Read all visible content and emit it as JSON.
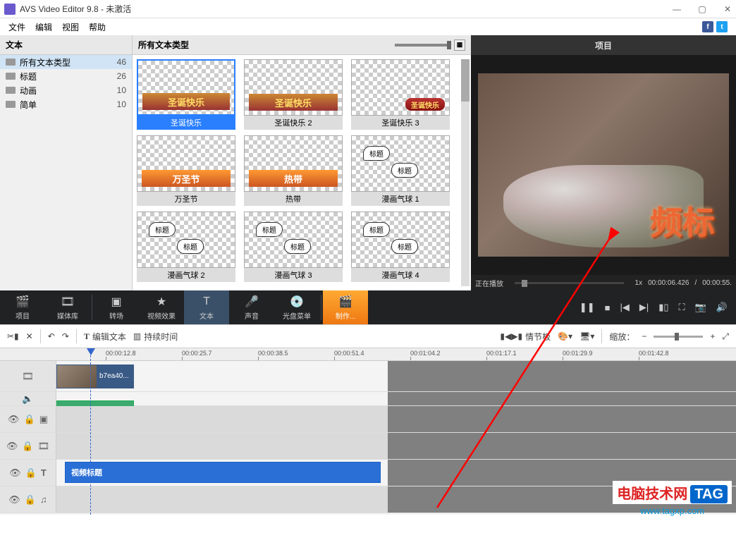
{
  "app": {
    "title": "AVS Video Editor 9.8 - 未激活"
  },
  "menu": {
    "file": "文件",
    "edit": "编辑",
    "view": "视图",
    "help": "帮助"
  },
  "sidebar": {
    "header": "文本",
    "items": [
      {
        "label": "所有文本类型",
        "count": "46",
        "selected": true
      },
      {
        "label": "标题",
        "count": "26"
      },
      {
        "label": "动画",
        "count": "10"
      },
      {
        "label": "简单",
        "count": "10"
      }
    ]
  },
  "gallery": {
    "header": "所有文本类型",
    "thumbs": [
      {
        "label": "圣诞快乐",
        "mode": "banner-red",
        "text": "圣诞快乐",
        "selected": true
      },
      {
        "label": "圣诞快乐 2",
        "mode": "banner-red",
        "text": "圣诞快乐"
      },
      {
        "label": "圣诞快乐 3",
        "mode": "ribbon-red",
        "text": "圣诞快乐"
      },
      {
        "label": "万圣节",
        "mode": "banner-orange",
        "text": "万圣节"
      },
      {
        "label": "热带",
        "mode": "banner-orange",
        "text": "热带"
      },
      {
        "label": "漫画气球 1",
        "mode": "bubbles",
        "b1": "标题",
        "b2": "标题"
      },
      {
        "label": "漫画气球 2",
        "mode": "bubbles",
        "b1": "标题",
        "b2": "标题"
      },
      {
        "label": "漫画气球 3",
        "mode": "bubbles",
        "b1": "标题",
        "b2": "标题"
      },
      {
        "label": "漫画气球 4",
        "mode": "bubbles",
        "b1": "标题",
        "b2": "标题"
      }
    ]
  },
  "preview": {
    "header": "项目",
    "overlay_text": "频标",
    "status_playing": "正在播放",
    "speed": "1x",
    "time_current": "00:00:06.426",
    "time_total": "00:00:55."
  },
  "tools": {
    "project": "项目",
    "media": "媒体库",
    "transition": "转场",
    "effects": "视频效果",
    "text": "文本",
    "sound": "声音",
    "disc": "光盘菜单",
    "make": "制作..."
  },
  "editbar": {
    "edit_text": "编辑文本",
    "duration": "持续时间",
    "storyboard": "情节板",
    "zoom": "缩放："
  },
  "timeline": {
    "marks": [
      "00:00:12.8",
      "00:00:25.7",
      "00:00:38.5",
      "00:00:51.4",
      "00:01:04.2",
      "00:01:17.1",
      "00:01:29.9",
      "00:01:42.8"
    ],
    "video_clip": "b7ea40...",
    "text_clip": "视频标题"
  },
  "watermark": {
    "site_cn": "电脑技术网",
    "tag": "TAG",
    "url": "www.tagxp.com"
  }
}
